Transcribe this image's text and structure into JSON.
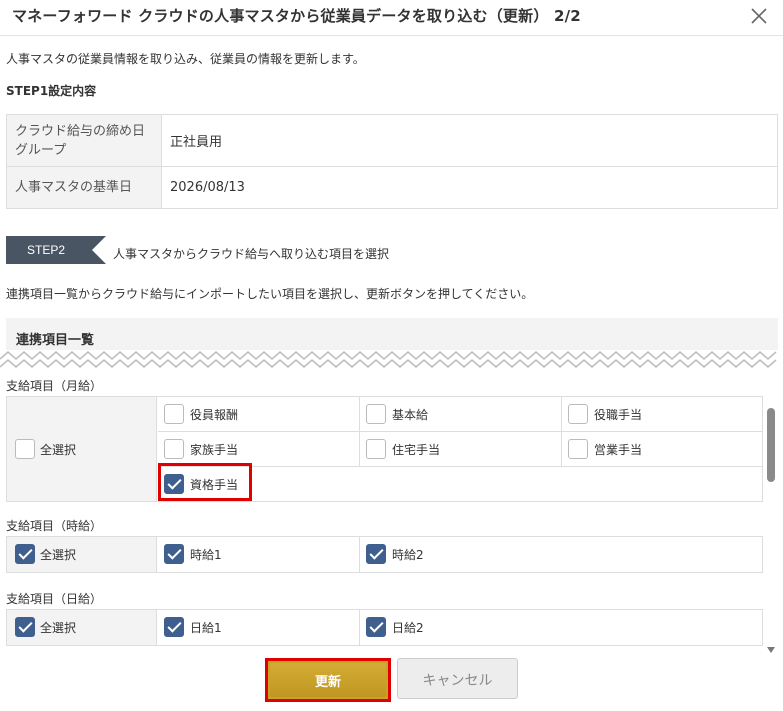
{
  "header": {
    "title": "マネーフォワード クラウドの人事マスタから従業員データを取り込む（更新） 2/2"
  },
  "description": "人事マスタの従業員情報を取り込み、従業員の情報を更新します。",
  "step1": {
    "label": "STEP1設定内容",
    "rows": [
      {
        "key": "クラウド給与の締め日グループ",
        "value": "正社員用"
      },
      {
        "key": "人事マスタの基準日",
        "value": "2026/08/13"
      }
    ]
  },
  "step2": {
    "badge": "STEP2",
    "text": "人事マスタからクラウド給与へ取り込む項目を選択"
  },
  "instruction": "連携項目一覧からクラウド給与にインポートしたい項目を選択し、更新ボタンを押してください。",
  "list": {
    "title": "連携項目一覧",
    "sections": [
      {
        "label": "支給項目（月給）",
        "select_all": {
          "label": "全選択",
          "checked": false
        },
        "items": [
          {
            "label": "役員報酬",
            "checked": false
          },
          {
            "label": "基本給",
            "checked": false
          },
          {
            "label": "役職手当",
            "checked": false
          },
          {
            "label": "家族手当",
            "checked": false
          },
          {
            "label": "住宅手当",
            "checked": false
          },
          {
            "label": "営業手当",
            "checked": false
          },
          {
            "label": "資格手当",
            "checked": true
          }
        ]
      },
      {
        "label": "支給項目（時給）",
        "select_all": {
          "label": "全選択",
          "checked": true
        },
        "items": [
          {
            "label": "時給1",
            "checked": true
          },
          {
            "label": "時給2",
            "checked": true
          }
        ]
      },
      {
        "label": "支給項目（日給）",
        "select_all": {
          "label": "全選択",
          "checked": true
        },
        "items": [
          {
            "label": "日給1",
            "checked": true
          },
          {
            "label": "日給2",
            "checked": true
          }
        ]
      }
    ]
  },
  "buttons": {
    "update": "更新",
    "cancel": "キャンセル"
  },
  "colors": {
    "accent": "#c9a227",
    "checkbox": "#3f5f8f",
    "highlight": "#e00000",
    "step_badge": "#4a5563"
  }
}
